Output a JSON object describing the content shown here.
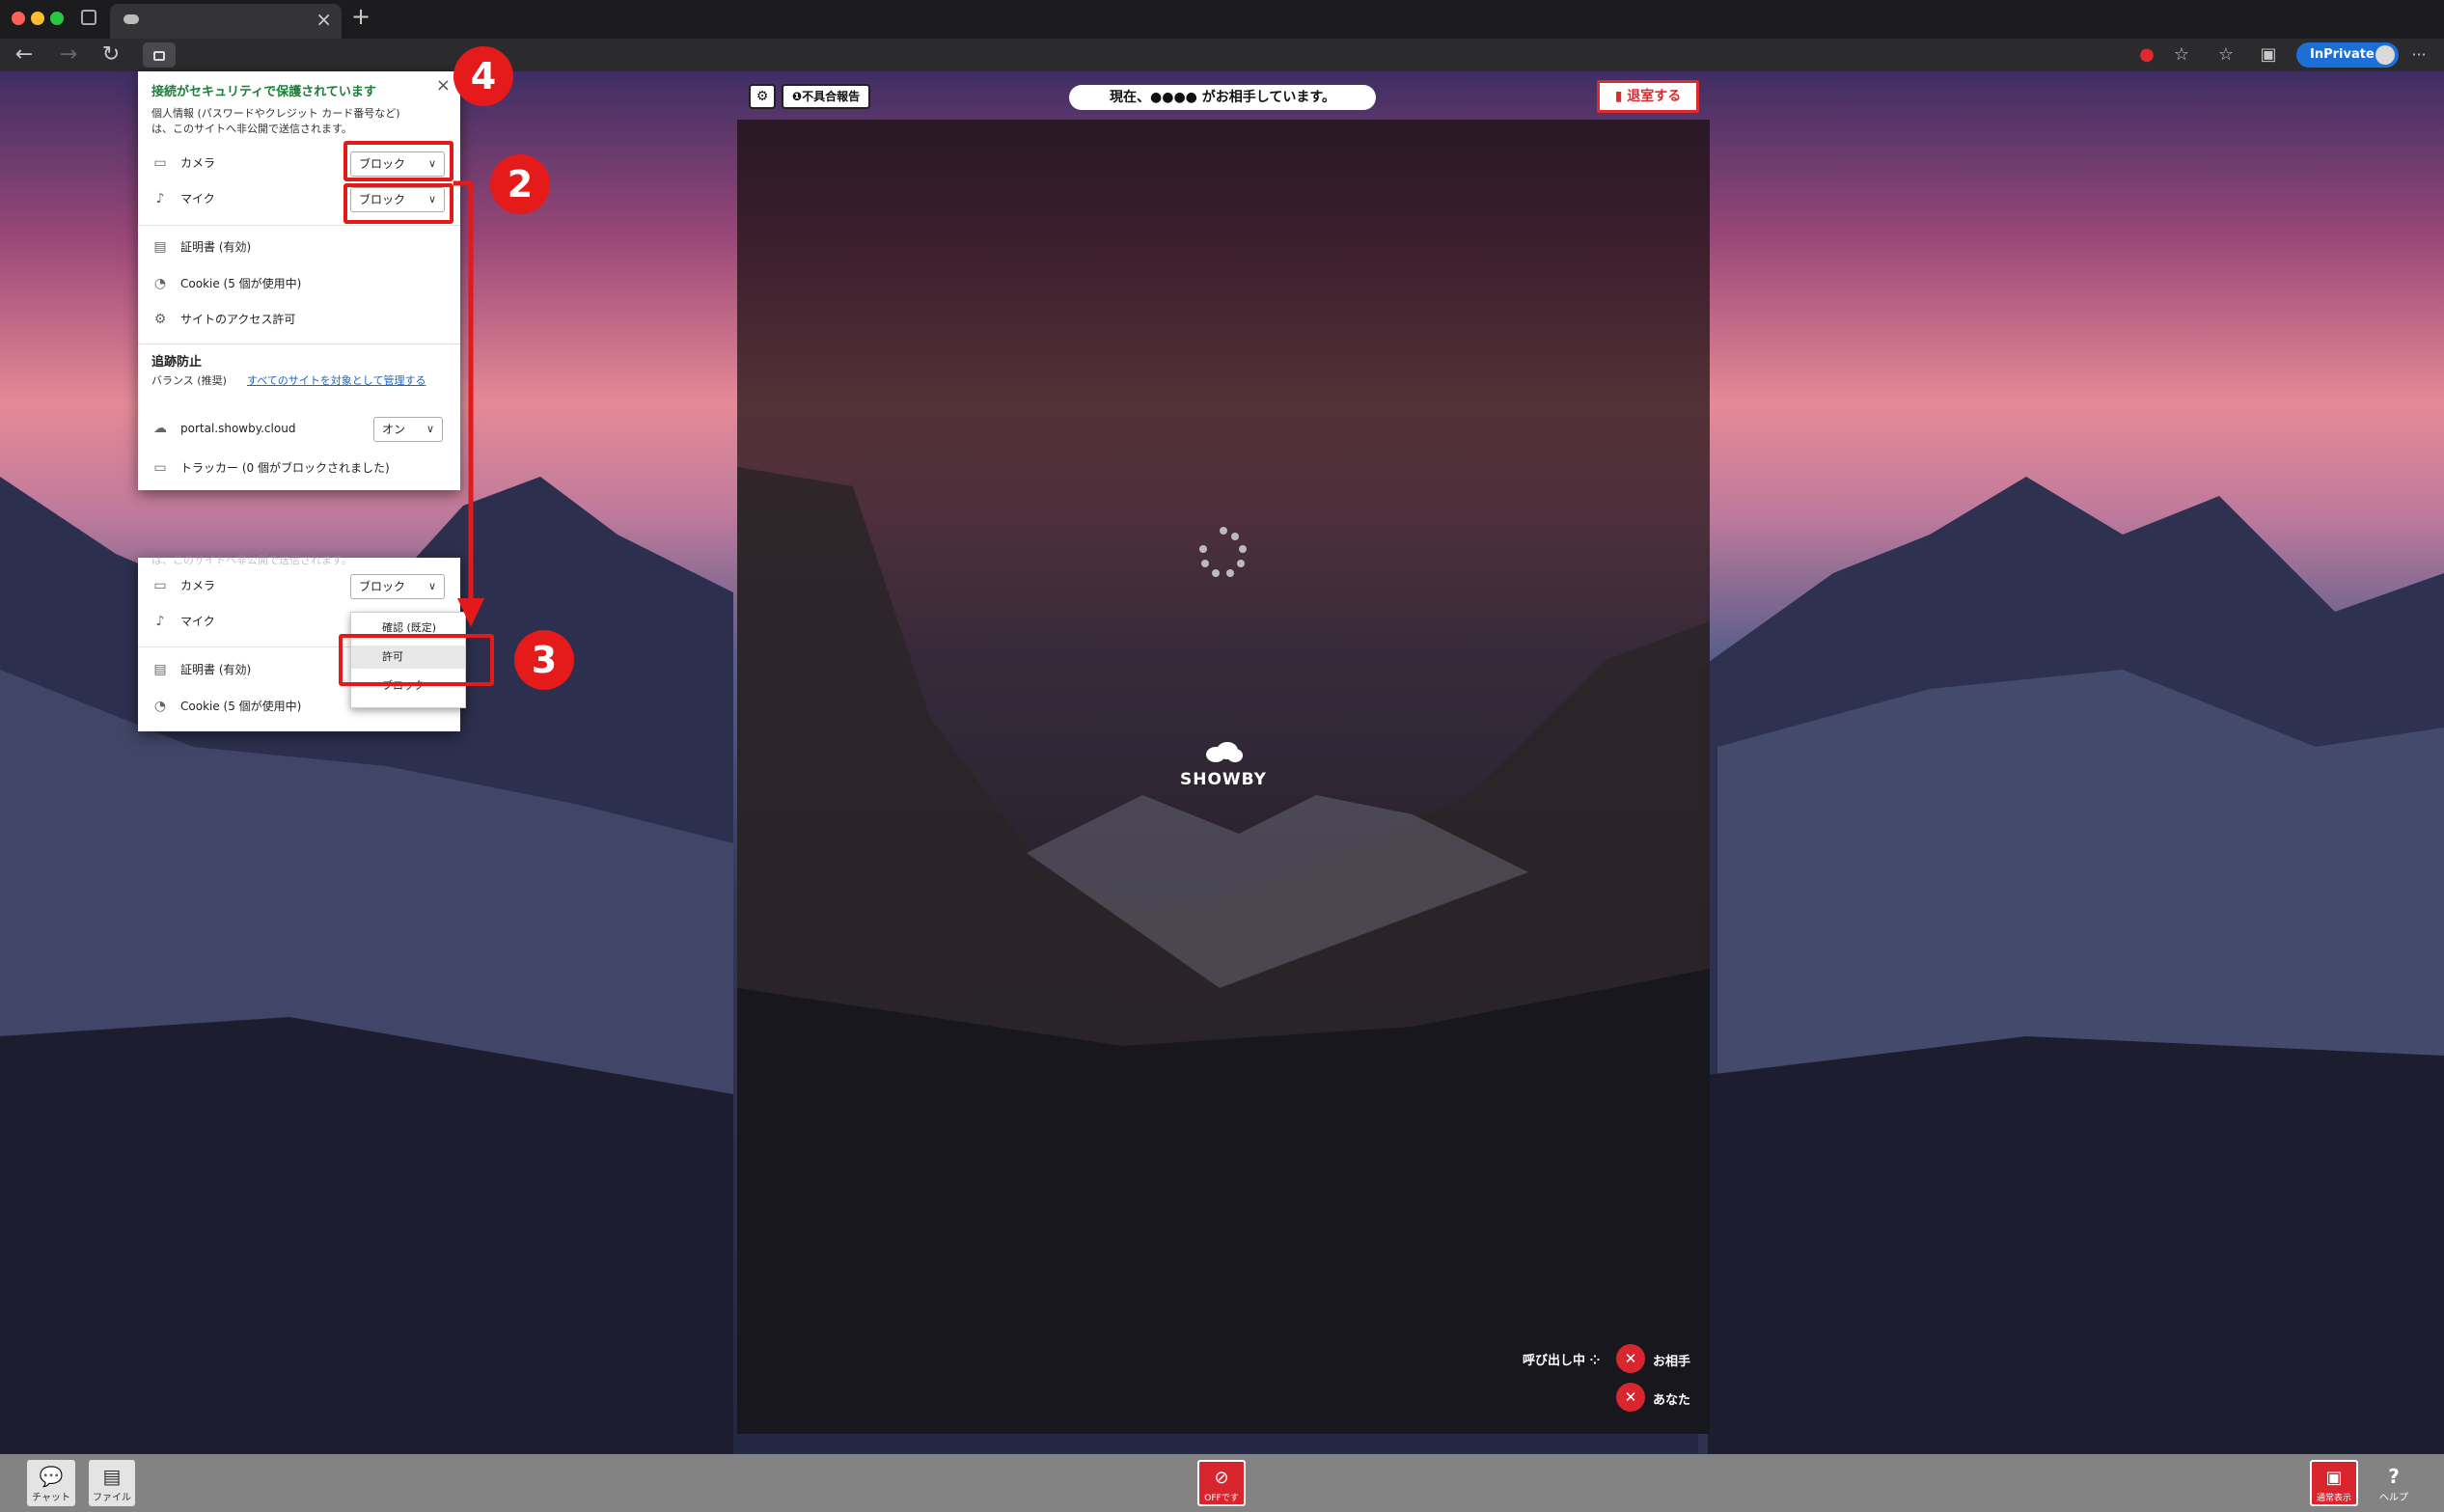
{
  "browser": {
    "tab_close": "×",
    "new_tab": "+",
    "inprivate_label": "InPrivate",
    "more": "···"
  },
  "app": {
    "settings_icon": "gear-icon",
    "report_button": "不具合報告",
    "status_text": "現在、●●●● がお相手しています。",
    "leave_button": "退室する",
    "logo_text": "SHOWBY",
    "calling_text": "呼び出し中",
    "partner_label": "お相手",
    "self_label": "あなた"
  },
  "site_info": {
    "title": "接続がセキュリティで保護されています",
    "description_line1": "個人情報 (パスワードやクレジット カード番号など)",
    "description_line2": "は、このサイトへ非公開で送信されます。",
    "camera_label": "カメラ",
    "camera_value": "ブロック",
    "mic_label": "マイク",
    "mic_value": "ブロック",
    "certificate": "証明書 (有効)",
    "cookie": "Cookie (5 個が使用中)",
    "site_permissions": "サイトのアクセス許可",
    "tracking_title": "追跡防止",
    "tracking_mode": "バランス (推奨)",
    "tracking_link": "すべてのサイトを対象として管理する",
    "site_domain": "portal.showby.cloud",
    "site_toggle": "オン",
    "tracker": "トラッカー (0 個がブロックされました)"
  },
  "dropdown_panel": {
    "cut_text": "は、このサイトへ非公開で送信されます。",
    "camera_label": "カメラ",
    "camera_value": "ブロック",
    "mic_label": "マイク",
    "options": [
      "確認 (既定)",
      "許可",
      "ブロック"
    ],
    "certificate": "証明書 (有効)",
    "cookie": "Cookie (5 個が使用中)"
  },
  "annotations": {
    "step2": "2",
    "step3": "3",
    "step4": "4"
  },
  "bottom_bar": {
    "chat_label": "チャット",
    "file_label": "ファイル",
    "camera_off_label": "OFFです",
    "normal_view_label": "通常表示",
    "help_label": "ヘルプ"
  },
  "colors": {
    "accent_red": "#e0282f",
    "secure_green": "#1a7f37",
    "link_blue": "#1a66c9",
    "inprivate_blue": "#1d6fd8"
  }
}
